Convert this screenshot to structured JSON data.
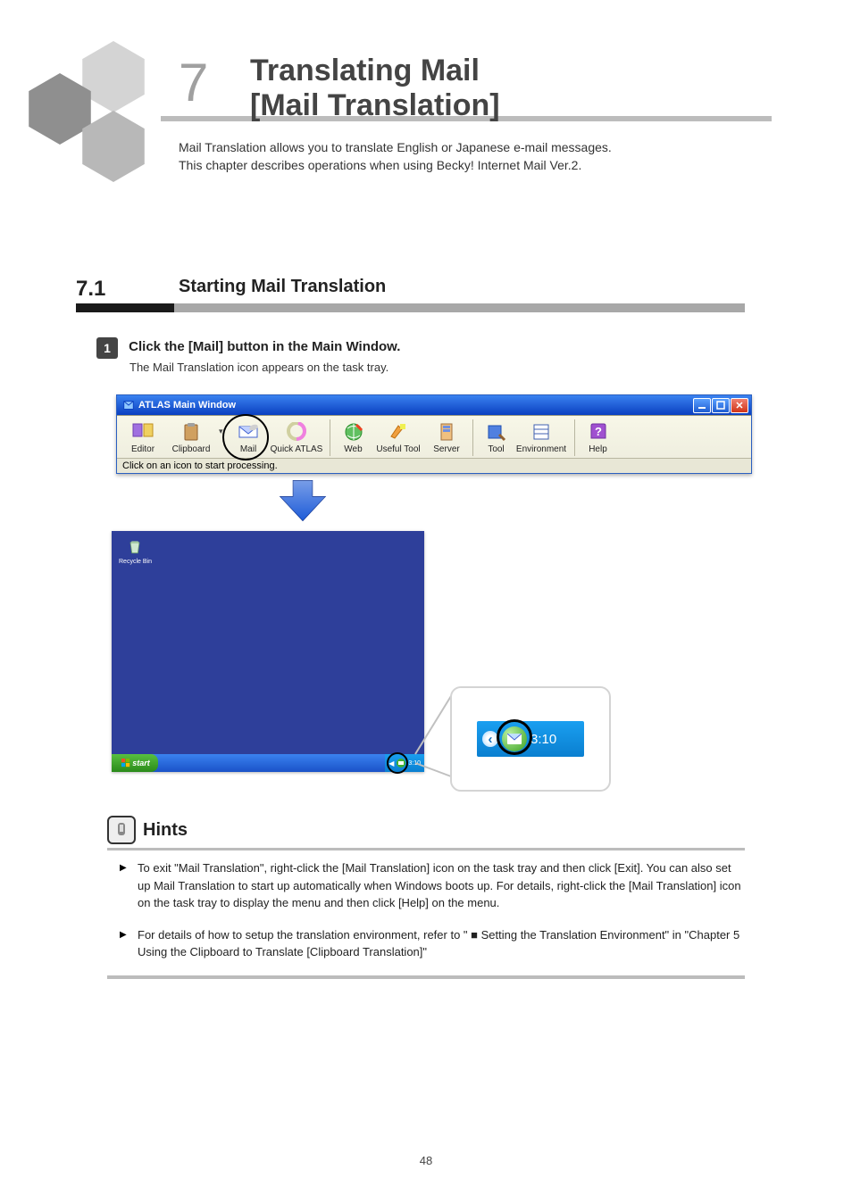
{
  "chapter": {
    "number": "7",
    "title_line1": "Translating Mail",
    "title_line2": "[Mail Translation]",
    "subtitle": "Mail Translation allows you to translate English or Japanese e-mail messages.\nThis chapter describes operations when using Becky! Internet Mail Ver.2."
  },
  "section": {
    "number": "7.1",
    "title": "Starting Mail Translation"
  },
  "step1": {
    "number": "1",
    "text": "Click the [Mail] button in the Main Window.",
    "followup": "The Mail Translation icon appears on the task tray."
  },
  "atlas_window": {
    "title": "ATLAS Main Window",
    "status": "Click on an icon to start processing.",
    "toolbar": [
      {
        "label": "Editor"
      },
      {
        "label": "Clipboard"
      },
      {
        "label": "Mail"
      },
      {
        "label": "Quick ATLAS"
      },
      {
        "label": "Web"
      },
      {
        "label": "Useful Tool"
      },
      {
        "label": "Server"
      },
      {
        "label": "Tool"
      },
      {
        "label": "Environment"
      },
      {
        "label": "Help"
      }
    ]
  },
  "desktop": {
    "recycle_bin": "Recycle Bin",
    "start": "start",
    "tray_time": "3:10"
  },
  "tray_zoom": {
    "time": "3:10"
  },
  "hints": {
    "heading": "Hints",
    "items": [
      "To exit \"Mail Translation\", right-click the [Mail Translation] icon on the task tray and then click [Exit]. You can also set up Mail Translation to start up automatically when Windows boots up. For details, right-click the [Mail Translation] icon on the task tray to display the menu and then click [Help] on the menu.",
      "For details of how to setup the translation environment, refer to \" ■ Setting the Translation Environment\" in \"Chapter 5 Using the Clipboard to Translate [Clipboard Translation]\""
    ]
  },
  "page_number": "48"
}
